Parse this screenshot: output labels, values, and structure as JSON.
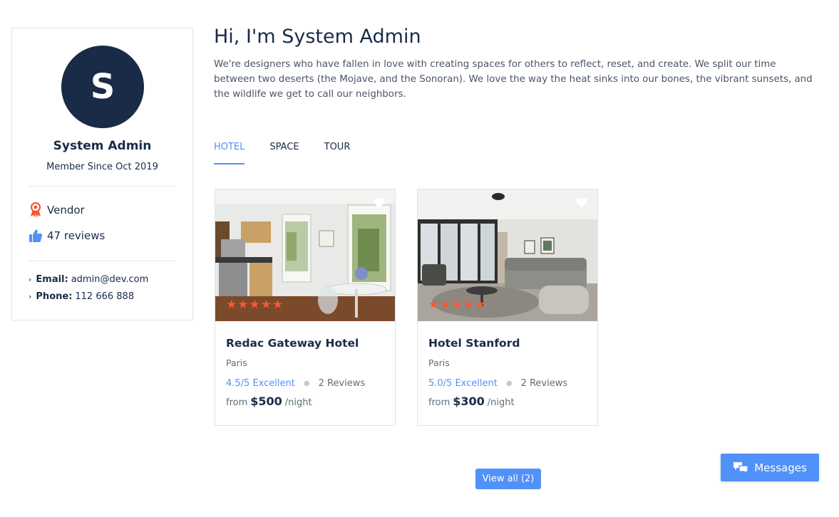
{
  "colors": {
    "accent": "#5191fa",
    "dark": "#1a2b48",
    "star": "#fa5636"
  },
  "profile": {
    "initial": "S",
    "name": "System Admin",
    "member_since": "Member Since Oct 2019",
    "role": "Vendor",
    "reviews": "47 reviews",
    "email_label": "Email:",
    "email": "admin@dev.com",
    "phone_label": "Phone:",
    "phone": "112 666 888"
  },
  "intro": {
    "greeting": "Hi, I'm System Admin",
    "bio": "We're designers who have fallen in love with creating spaces for others to reflect, reset, and create. We split our time between two deserts (the Mojave, and the Sonoran). We love the way the heat sinks into our bones, the vibrant sunsets, and the wildlife we get to call our neighbors."
  },
  "tabs": [
    {
      "label": "HOTEL",
      "active": true
    },
    {
      "label": "SPACE",
      "active": false
    },
    {
      "label": "TOUR",
      "active": false
    }
  ],
  "listings": [
    {
      "title": "Redac Gateway Hotel",
      "location": "Paris",
      "score": "4.5/5 Excellent",
      "reviews": "2 Reviews",
      "from": "from",
      "price": "$500",
      "unit": "/night",
      "stars": 5,
      "icon": "kitchen-photo"
    },
    {
      "title": "Hotel Stanford",
      "location": "Paris",
      "score": "5.0/5 Excellent",
      "reviews": "2 Reviews",
      "from": "from",
      "price": "$300",
      "unit": "/night",
      "stars": 5,
      "icon": "living-room-photo"
    }
  ],
  "buttons": {
    "view_all": "View all (2)",
    "messages": "Messages"
  }
}
